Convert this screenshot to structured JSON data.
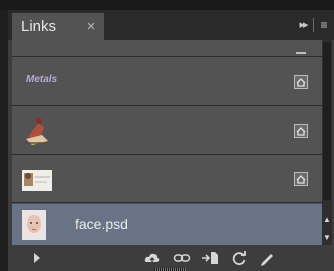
{
  "panel": {
    "tab_title": "Links",
    "tab_close": "×"
  },
  "header": {
    "collapse_glyph": "▸▸",
    "menu_glyph": "≡"
  },
  "links": [
    {
      "name": "",
      "type": "partial-row",
      "status_icon": "missing-status-icon"
    },
    {
      "name": "Metals",
      "type": "swatch-text",
      "status_icon": "modified-status-icon"
    },
    {
      "name": "",
      "type": "thumbnail-shoe",
      "status_icon": "modified-status-icon"
    },
    {
      "name": "",
      "type": "thumbnail-photo",
      "status_icon": "modified-status-icon"
    },
    {
      "name": "face.psd",
      "type": "thumbnail-face",
      "selected": true
    }
  ],
  "toolbar": {
    "buttons": [
      "show-link-info-icon",
      "relink-cc-library-icon",
      "go-to-link-icon",
      "embed-link-icon",
      "update-link-icon",
      "edit-original-icon"
    ]
  },
  "colors": {
    "panel_bg": "#3d3d3d",
    "row_bg": "#535353",
    "selected_bg": "#687486",
    "metals_text": "#b7a9dc"
  }
}
